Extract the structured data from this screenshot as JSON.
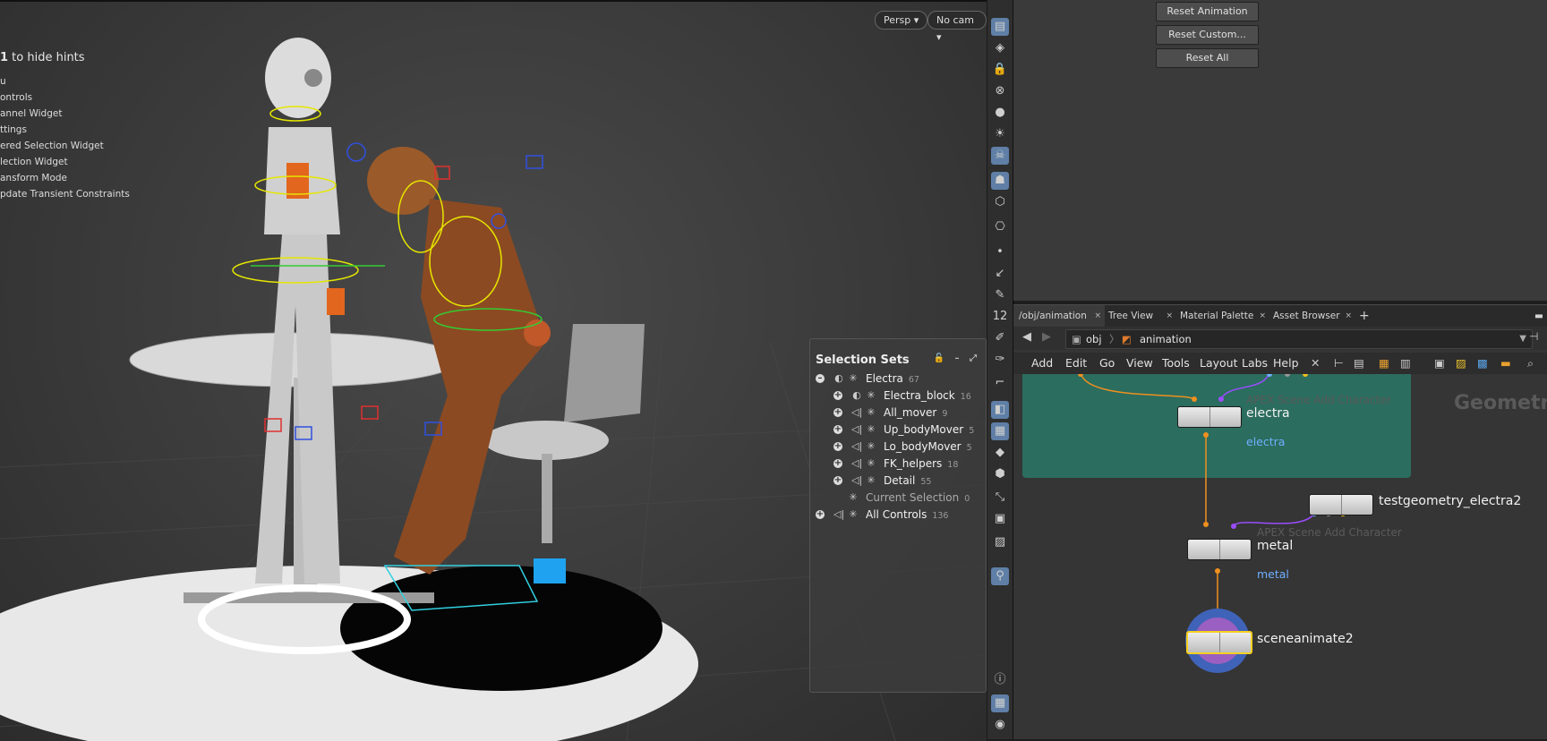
{
  "viewport": {
    "hints_first": "1 to hide hints",
    "hints_first_key": "1",
    "hints_first_rest": " to hide hints",
    "hint_rows": [
      "u",
      "ontrols",
      "annel Widget",
      "ttings",
      "ered Selection Widget",
      "lection Widget",
      "ansform Mode",
      "pdate Transient Constraints"
    ],
    "persp_label": "Persp ▾",
    "cam_label": "No cam ▾"
  },
  "selection_sets": {
    "title": "Selection Sets",
    "rows": [
      {
        "name": "Electra",
        "count": "67"
      },
      {
        "name": "Electra_block",
        "count": "16"
      },
      {
        "name": "All_mover",
        "count": "9"
      },
      {
        "name": "Up_bodyMover",
        "count": "5"
      },
      {
        "name": "Lo_bodyMover",
        "count": "5"
      },
      {
        "name": "FK_helpers",
        "count": "18"
      },
      {
        "name": "Detail",
        "count": "55"
      },
      {
        "name": "Current Selection",
        "count": "0"
      },
      {
        "name": "All Controls",
        "count": "136"
      }
    ]
  },
  "params": {
    "reset_animation": "Reset Animation",
    "reset_custom": "Reset Custom...",
    "reset_all": "Reset All"
  },
  "network": {
    "tabs": [
      "/obj/animation",
      "Tree View",
      "Material Palette",
      "Asset Browser"
    ],
    "path_obj": "obj",
    "path_current": "animation",
    "menu": [
      "Add",
      "Edit",
      "Go",
      "View",
      "Tools",
      "Layout",
      "Labs",
      "Help"
    ],
    "context_label": "Geometry",
    "nodes": {
      "electra": {
        "type": "APEX Scene Add Character",
        "name": "electra",
        "comment": "electra"
      },
      "testgeo": {
        "name": "testgeometry_electra2"
      },
      "metal": {
        "type": "APEX Scene Add Character",
        "name": "metal",
        "comment": "metal"
      },
      "sceneanimate": {
        "name": "sceneanimate2"
      }
    }
  },
  "colors": {
    "network_box": "#2b6d5f",
    "wire_orange": "#f0901e",
    "wire_purple": "#9b4dff",
    "selected_node": "#f5d020"
  }
}
